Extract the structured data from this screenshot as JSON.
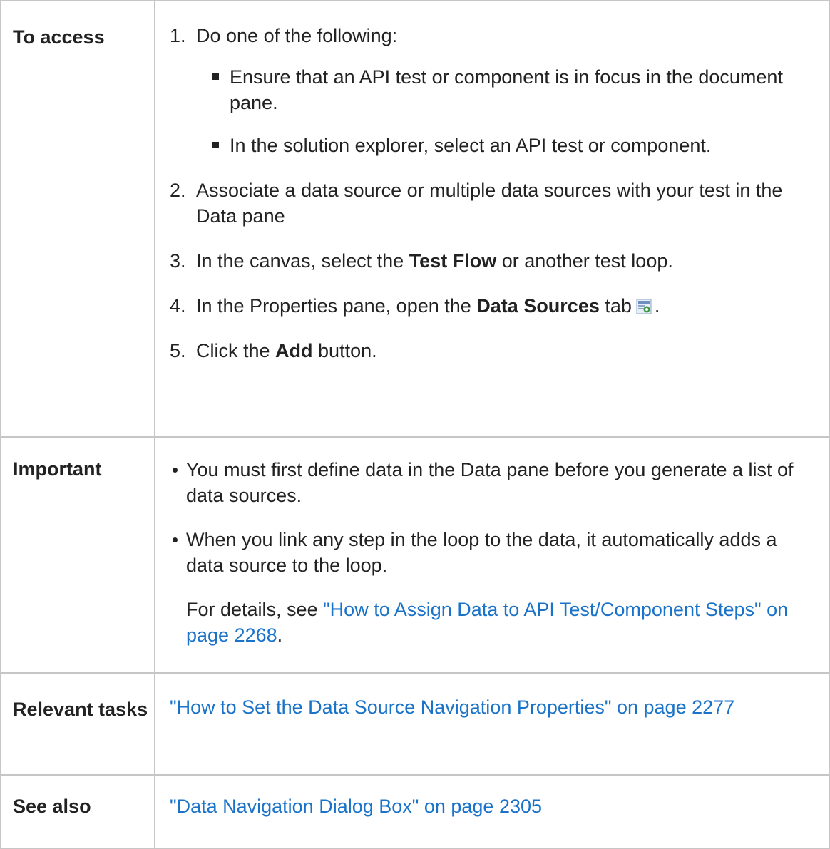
{
  "rows": {
    "access": {
      "label": "To access",
      "step1_num": "1.",
      "step1_text": "Do one of the following:",
      "step1_sub": [
        "Ensure that an API test or component is in focus in the document pane.",
        "In the solution explorer, select an API test or component."
      ],
      "step2_num": "2.",
      "step2_text": "Associate a data source or multiple data sources with your test in the Data pane",
      "step3_num": "3.",
      "step3_pre": "In the canvas, select the ",
      "step3_bold": "Test Flow",
      "step3_post": " or another test loop.",
      "step4_num": "4.",
      "step4_pre": "In the Properties pane, open the ",
      "step4_bold": "Data Sources",
      "step4_post": " tab",
      "step4_end": ".",
      "step4_icon": "data-sources-tab-icon",
      "step5_num": "5.",
      "step5_pre": "Click the ",
      "step5_bold": "Add",
      "step5_post": " button."
    },
    "important": {
      "label": "Important",
      "bullets": [
        "You must first define data in the Data pane before you generate a list of data sources.",
        "When you link any step in the loop to the data, it automatically adds a data source to the loop."
      ],
      "details_pre": "For details, see ",
      "details_link": "\"How to Assign Data to API Test/Component Steps\" on page 2268",
      "details_post": "."
    },
    "relevant": {
      "label": "Relevant tasks",
      "link": "\"How to Set the Data Source Navigation Properties\" on page 2277"
    },
    "see_also": {
      "label": "See also",
      "link": "\"Data Navigation Dialog Box\" on page 2305"
    }
  },
  "colors": {
    "link": "#1a73c9",
    "border": "#c6c6c6",
    "text": "#222222"
  }
}
